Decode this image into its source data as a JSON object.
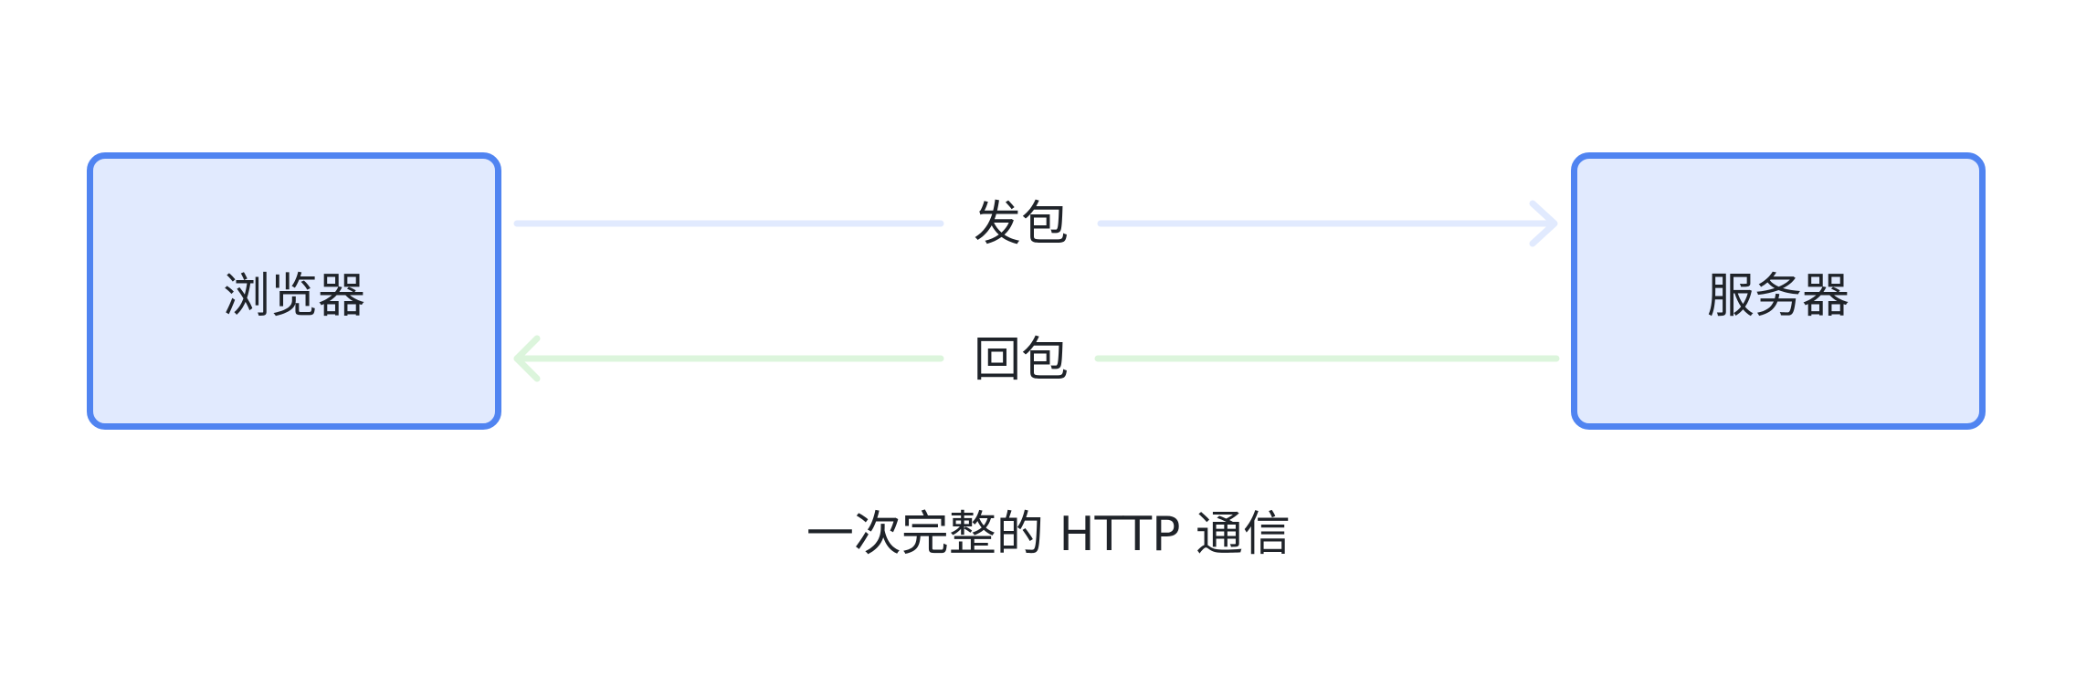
{
  "nodes": {
    "browser": "浏览器",
    "server": "服务器"
  },
  "edges": {
    "send": "发包",
    "reply": "回包"
  },
  "caption": "一次完整的 HTTP 通信",
  "colors": {
    "node_fill": "#e1eafe",
    "node_border": "#5084f1",
    "send_arrow": "#e1eafe",
    "reply_arrow": "#dcf5dc",
    "text": "#1f2329"
  }
}
